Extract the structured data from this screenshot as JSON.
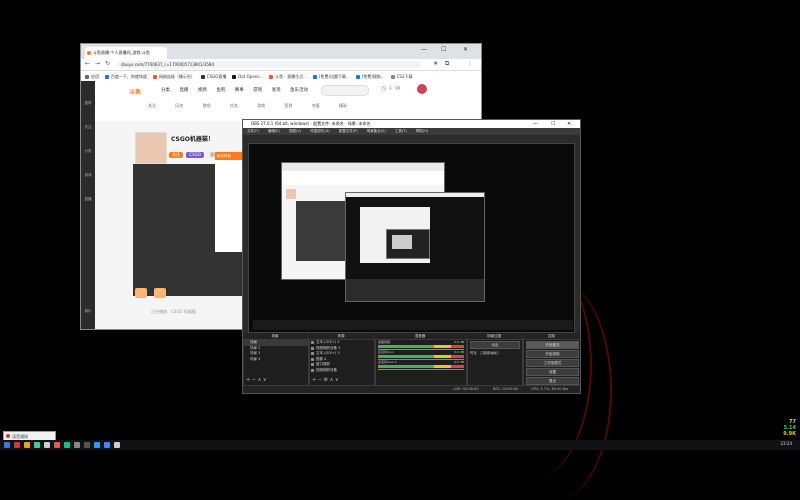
{
  "browser": {
    "tab_title": "斗鱼直播-个人直播间_游戏-斗鱼",
    "url": "douyu.com/7740637_r=1700005713801/3584",
    "bookmarks": [
      "应用",
      "百度一下，你就知道",
      "网络连接（播示台）",
      "CSGO直播",
      "Dot Opens...",
      "斗鱼 - 直播生活...",
      "(免费)迅雷下载...",
      "(免费)搜狗...",
      "CS2下载"
    ],
    "nav": [
      "分类",
      "直播",
      "视频",
      "鱼吧",
      "赛事",
      "游戏",
      "发现",
      "鱼乐活动"
    ],
    "categories": [
      "关注",
      "历史",
      "鱼吧",
      "任务",
      "游戏",
      "签到",
      "充值",
      "精彩"
    ],
    "left_bar": [
      "推荐",
      "关注",
      "分类",
      "游戏",
      "直播",
      "娱乐"
    ],
    "streamer_name": "CSGO机器猫！",
    "tags": [
      "关注",
      "CSGO",
      "直播间",
      "热门"
    ],
    "chat_header": "粉丝特权",
    "bottom_text": "正在播放：CSGO 机器猫"
  },
  "obs": {
    "title": "OBS 27.0.1 (64 bit, windows) - 配置文件: 未命名 - 场景: 未命名",
    "menu": [
      "文件(F)",
      "编辑(E)",
      "视图(V)",
      "停靠部件(D)",
      "配置文件(P)",
      "场景集合(S)",
      "工具(T)",
      "帮助(H)"
    ],
    "docks": {
      "scenes": "场景",
      "sources": "来源",
      "mixer": "混音器",
      "transitions": "场景过渡",
      "controls": "控制"
    },
    "scenes": [
      "场景",
      "场景 2",
      "场景 3",
      "场景 4"
    ],
    "sources": [
      "文本 (GDI+) 4",
      "视频捕获设备 3",
      "文本 (GDI+) 3",
      "图像 4",
      "窗口捕获",
      "视频捕获设备"
    ],
    "mixer": [
      {
        "label": "桌面音频",
        "value": "0.0 dB"
      },
      {
        "label": "麦克风/Aux",
        "value": "0.0 dB"
      },
      {
        "label": "麦克风/Aux 2",
        "value": "0.0 dB"
      }
    ],
    "transition": {
      "type": "淡出",
      "duration_label": "时长",
      "duration": "300 ms"
    },
    "controls": [
      "开始推流",
      "开始录制",
      "工作室模式",
      "设置",
      "退出"
    ],
    "status": {
      "live": "LIVE: 00:00:00",
      "rec": "REC: 00:00:00",
      "cpu": "CPU: 2.7%, 60.00 fps"
    }
  },
  "desktop": {
    "popup": "语音通知",
    "monitor": [
      "77",
      "5.14",
      "9.9K"
    ],
    "clock": "23:24",
    "colors": {
      "monitor_1": "#b8e04a",
      "monitor_2": "#2ecf6a",
      "monitor_3": "#e7c53a"
    }
  }
}
